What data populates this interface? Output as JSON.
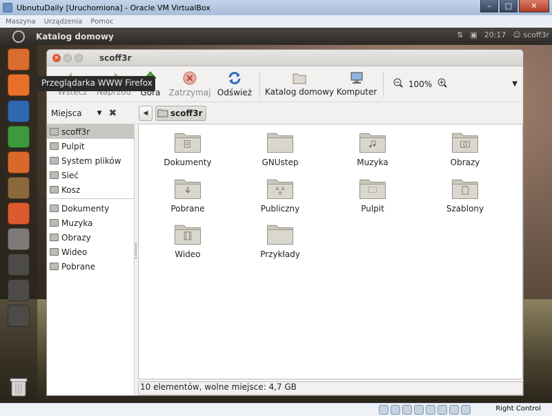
{
  "host": {
    "title": "UbnutuDaily [Uruchomiona] - Oracle VM VirtualBox",
    "menu": [
      "Maszyna",
      "Urządzenia",
      "Pomoc"
    ],
    "host_key": "Right Control"
  },
  "guest_panel": {
    "title": "Katalog domowy",
    "tray": [
      "⇅",
      "▣",
      "20:17",
      "☺ scoff3r"
    ]
  },
  "tooltip": "Przeglądarka WWW Firefox",
  "launcher": [
    {
      "name": "ubuntu-software-icon",
      "color": "#d96c2e"
    },
    {
      "name": "firefox-icon",
      "color": "#e8702a"
    },
    {
      "name": "writer-icon",
      "color": "#2f67b1"
    },
    {
      "name": "calc-icon",
      "color": "#3c9a3c"
    },
    {
      "name": "impress-icon",
      "color": "#d9682b"
    },
    {
      "name": "software-center-icon",
      "color": "#8a6a3d"
    },
    {
      "name": "ubuntu-one-icon",
      "color": "#dd5a2e"
    },
    {
      "name": "help-icon",
      "color": "#7c7b78"
    },
    {
      "name": "workspaces-icon",
      "color": "#4c4b48"
    },
    {
      "name": "lens-apps-icon",
      "color": "#4c4b48"
    },
    {
      "name": "lens-files-icon",
      "color": "#4c4b48"
    }
  ],
  "window": {
    "title": "scoff3r",
    "toolbar": {
      "back": "Wstecz",
      "forward": "Naprzód",
      "up": "Góra",
      "stop": "Zatrzymaj",
      "reload": "Odśwież",
      "home": "Katalog domowy",
      "computer": "Komputer",
      "zoom": "100%"
    },
    "sidebar_title": "Miejsca",
    "breadcrumb": "scoff3r",
    "places": [
      "scoff3r",
      "Pulpit",
      "System plików",
      "Sieć",
      "Kosz"
    ],
    "bookmarks": [
      "Dokumenty",
      "Muzyka",
      "Obrazy",
      "Wideo",
      "Pobrane"
    ],
    "files": [
      {
        "name": "Dokumenty",
        "glyph": "doc"
      },
      {
        "name": "GNUstep",
        "glyph": "none"
      },
      {
        "name": "Muzyka",
        "glyph": "music"
      },
      {
        "name": "Obrazy",
        "glyph": "camera"
      },
      {
        "name": "Pobrane",
        "glyph": "download"
      },
      {
        "name": "Publiczny",
        "glyph": "share"
      },
      {
        "name": "Pulpit",
        "glyph": "desktop"
      },
      {
        "name": "Szablony",
        "glyph": "template"
      },
      {
        "name": "Wideo",
        "glyph": "film"
      },
      {
        "name": "Przykłady",
        "glyph": "none"
      }
    ],
    "status": "10 elementów, wolne miejsce: 4,7 GB"
  }
}
